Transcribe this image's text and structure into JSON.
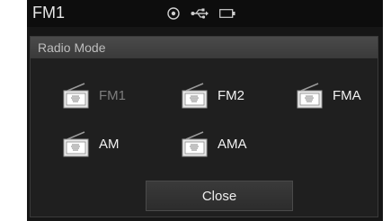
{
  "status_bar": {
    "title": "FM1",
    "icons": [
      "record-icon",
      "usb-icon",
      "battery-icon"
    ]
  },
  "dialog": {
    "title": "Radio Mode",
    "modes": [
      {
        "label": "FM1",
        "icon": "radio-icon",
        "selected": true
      },
      {
        "label": "FM2",
        "icon": "radio-icon",
        "selected": false
      },
      {
        "label": "FMA",
        "icon": "radio-icon",
        "selected": false
      },
      {
        "label": "AM",
        "icon": "radio-icon",
        "selected": false
      },
      {
        "label": "AMA",
        "icon": "radio-icon",
        "selected": false
      }
    ],
    "close_label": "Close"
  },
  "colors": {
    "background": "#161616",
    "text": "#f2f2f2",
    "selected_text": "#7d7d7d"
  }
}
